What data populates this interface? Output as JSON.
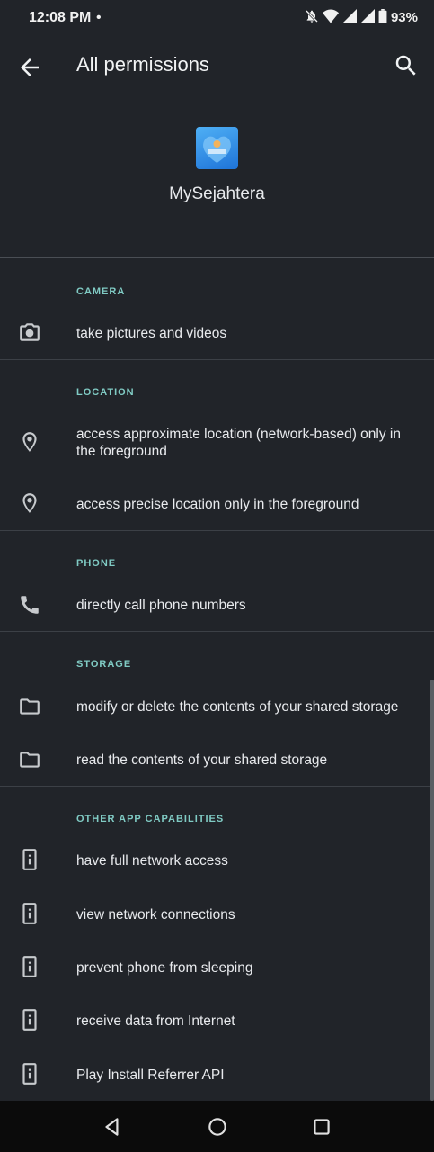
{
  "status_bar": {
    "time": "12:08 PM",
    "dot": "•",
    "battery_percent": "93%",
    "icons": [
      "mute-icon",
      "wifi-icon",
      "signal-icon",
      "signal-icon",
      "battery-icon"
    ]
  },
  "app_bar": {
    "title": "All permissions",
    "back_icon": "arrow-back-icon",
    "search_icon": "search-icon"
  },
  "app": {
    "name": "MySejahtera",
    "icon_text": "MySejahtera"
  },
  "sections": [
    {
      "header": "CAMERA",
      "items": [
        {
          "label": "take pictures and videos",
          "icon": "camera-icon"
        }
      ]
    },
    {
      "header": "LOCATION",
      "items": [
        {
          "label": "access approximate location (network-based) only in the foreground",
          "icon": "location-pin-icon"
        },
        {
          "label": "access precise location only in the foreground",
          "icon": "location-pin-icon"
        }
      ]
    },
    {
      "header": "PHONE",
      "items": [
        {
          "label": "directly call phone numbers",
          "icon": "phone-icon"
        }
      ]
    },
    {
      "header": "STORAGE",
      "items": [
        {
          "label": "modify or delete the contents of your shared storage",
          "icon": "folder-icon"
        },
        {
          "label": "read the contents of your shared storage",
          "icon": "folder-icon"
        }
      ]
    },
    {
      "header": "OTHER APP CAPABILITIES",
      "items": [
        {
          "label": "have full network access",
          "icon": "device-info-icon"
        },
        {
          "label": "view network connections",
          "icon": "device-info-icon"
        },
        {
          "label": "prevent phone from sleeping",
          "icon": "device-info-icon"
        },
        {
          "label": "receive data from Internet",
          "icon": "device-info-icon"
        },
        {
          "label": "Play Install Referrer API",
          "icon": "device-info-icon"
        }
      ]
    }
  ],
  "nav_bar": {
    "buttons": [
      "back-triangle-icon",
      "home-circle-icon",
      "recents-square-icon"
    ]
  },
  "colors": {
    "background": "#212429",
    "accent": "#80cbc4",
    "text": "#e8eaed"
  }
}
